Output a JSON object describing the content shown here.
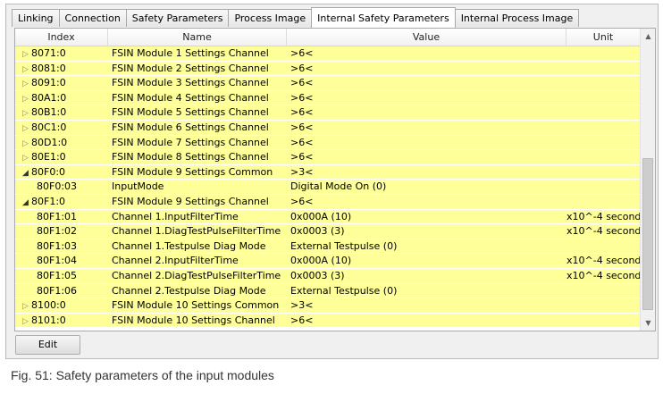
{
  "tabs": [
    {
      "label": "Linking",
      "active": false
    },
    {
      "label": "Connection",
      "active": false
    },
    {
      "label": "Safety Parameters",
      "active": false
    },
    {
      "label": "Process Image",
      "active": false
    },
    {
      "label": "Internal Safety Parameters",
      "active": true
    },
    {
      "label": "Internal Process Image",
      "active": false
    }
  ],
  "columns": [
    "Index",
    "Name",
    "Value",
    "Unit"
  ],
  "rows": [
    {
      "index": "8071:0",
      "name": "FSIN Module 1 Settings Channel",
      "value": ">6<",
      "unit": "",
      "level": 0,
      "expander": "collapsed"
    },
    {
      "index": "8081:0",
      "name": "FSIN Module 2 Settings Channel",
      "value": ">6<",
      "unit": "",
      "level": 0,
      "expander": "collapsed"
    },
    {
      "index": "8091:0",
      "name": "FSIN Module 3 Settings Channel",
      "value": ">6<",
      "unit": "",
      "level": 0,
      "expander": "collapsed"
    },
    {
      "index": "80A1:0",
      "name": "FSIN Module 4 Settings Channel",
      "value": ">6<",
      "unit": "",
      "level": 0,
      "expander": "collapsed"
    },
    {
      "index": "80B1:0",
      "name": "FSIN Module 5 Settings Channel",
      "value": ">6<",
      "unit": "",
      "level": 0,
      "expander": "collapsed"
    },
    {
      "index": "80C1:0",
      "name": "FSIN Module 6 Settings Channel",
      "value": ">6<",
      "unit": "",
      "level": 0,
      "expander": "collapsed"
    },
    {
      "index": "80D1:0",
      "name": "FSIN Module 7 Settings Channel",
      "value": ">6<",
      "unit": "",
      "level": 0,
      "expander": "collapsed"
    },
    {
      "index": "80E1:0",
      "name": "FSIN Module 8 Settings Channel",
      "value": ">6<",
      "unit": "",
      "level": 0,
      "expander": "collapsed"
    },
    {
      "index": "80F0:0",
      "name": "FSIN Module 9 Settings Common",
      "value": ">3<",
      "unit": "",
      "level": 0,
      "expander": "expanded"
    },
    {
      "index": "80F0:03",
      "name": "InputMode",
      "value": "Digital Mode On (0)",
      "unit": "",
      "level": 1,
      "expander": "none"
    },
    {
      "index": "80F1:0",
      "name": "FSIN Module 9 Settings Channel",
      "value": ">6<",
      "unit": "",
      "level": 0,
      "expander": "expanded"
    },
    {
      "index": "80F1:01",
      "name": "Channel 1.InputFilterTime",
      "value": "0x000A (10)",
      "unit": "x10^-4 second",
      "level": 1,
      "expander": "none"
    },
    {
      "index": "80F1:02",
      "name": "Channel 1.DiagTestPulseFilterTime",
      "value": "0x0003 (3)",
      "unit": "x10^-4 second",
      "level": 1,
      "expander": "none"
    },
    {
      "index": "80F1:03",
      "name": "Channel 1.Testpulse Diag Mode",
      "value": "External Testpulse (0)",
      "unit": "",
      "level": 1,
      "expander": "none"
    },
    {
      "index": "80F1:04",
      "name": "Channel 2.InputFilterTime",
      "value": "0x000A (10)",
      "unit": "x10^-4 second",
      "level": 1,
      "expander": "none"
    },
    {
      "index": "80F1:05",
      "name": "Channel 2.DiagTestPulseFilterTime",
      "value": "0x0003 (3)",
      "unit": "x10^-4 second",
      "level": 1,
      "expander": "none"
    },
    {
      "index": "80F1:06",
      "name": "Channel 2.Testpulse Diag Mode",
      "value": "External Testpulse (0)",
      "unit": "",
      "level": 1,
      "expander": "none"
    },
    {
      "index": "8100:0",
      "name": "FSIN Module 10 Settings Common",
      "value": ">3<",
      "unit": "",
      "level": 0,
      "expander": "collapsed"
    },
    {
      "index": "8101:0",
      "name": "FSIN Module 10 Settings Channel",
      "value": ">6<",
      "unit": "",
      "level": 0,
      "expander": "collapsed"
    }
  ],
  "icons": {
    "collapsed": "▷",
    "expanded": "◢",
    "scroll_up": "▲",
    "scroll_down": "▼"
  },
  "edit_button": "Edit",
  "caption": "Fig. 51: Safety parameters of the input modules",
  "colors": {
    "row_highlight": "#ffff99"
  }
}
